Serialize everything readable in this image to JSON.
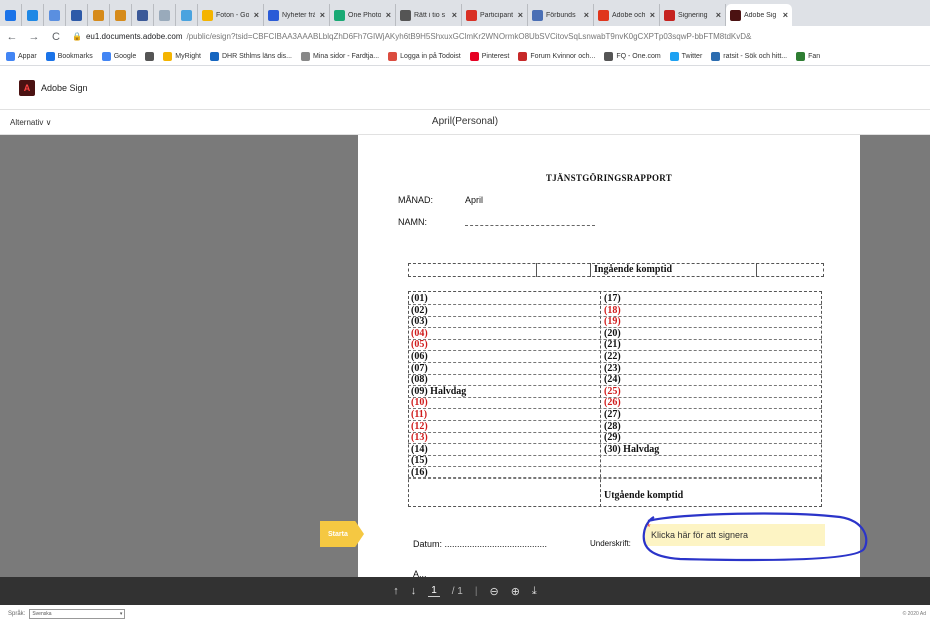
{
  "tabs": [
    {
      "label": "",
      "color": "#1b73e8",
      "active": false
    },
    {
      "label": "",
      "color": "#1e88e5",
      "active": false
    },
    {
      "label": "",
      "color": "#5a8fe0",
      "active": false
    },
    {
      "label": "",
      "color": "#2e5aa8",
      "active": false
    },
    {
      "label": "",
      "color": "#d68b1b",
      "active": false
    },
    {
      "label": "",
      "color": "#d68b1b",
      "active": false
    },
    {
      "label": "",
      "color": "#3b5998",
      "active": false
    },
    {
      "label": "",
      "color": "#9ab",
      "active": false
    },
    {
      "label": "",
      "color": "#4aa3df",
      "active": false
    },
    {
      "label": "Foton - Go",
      "color": "#f4b400",
      "active": false
    },
    {
      "label": "Nyheter frå",
      "color": "#2a5bd7",
      "active": false
    },
    {
      "label": "One Photo",
      "color": "#19a974",
      "active": false
    },
    {
      "label": "Rätt i tio s",
      "color": "#555",
      "active": false
    },
    {
      "label": "Participant",
      "color": "#d93025",
      "active": false
    },
    {
      "label": "Förbunds",
      "color": "#4a6fb5",
      "active": false
    },
    {
      "label": "Adobe och",
      "color": "#e0361c",
      "active": false
    },
    {
      "label": "Signering",
      "color": "#c5221f",
      "active": false
    },
    {
      "label": "Adobe Sig",
      "color": "#4b1212",
      "active": true
    }
  ],
  "addressbar": {
    "host": "eu1.documents.adobe.com",
    "path": "/public/esign?tsid=CBFCIBAA3AAABLblqZhD6Fh7GIWjAKyh6tB9H5ShxuxGClmKr2WNOrmkO8UbSVCitovSqLsnwabT9nvK0gCXPTp03sqwP-bbFTM8tdKvD&"
  },
  "bookmarks": [
    {
      "label": "Appar",
      "color": "#4285f4"
    },
    {
      "label": "Bookmarks",
      "color": "#1a73e8"
    },
    {
      "label": "Google",
      "color": "#4285f4"
    },
    {
      "label": "",
      "color": "#555"
    },
    {
      "label": "MyRight",
      "color": "#f4b400"
    },
    {
      "label": "DHR Sthlms läns dis...",
      "color": "#1565c0"
    },
    {
      "label": "Mina sidor - Fardtja...",
      "color": "#888"
    },
    {
      "label": "Logga in på Todoist",
      "color": "#db4c3f"
    },
    {
      "label": "Pinterest",
      "color": "#e60023"
    },
    {
      "label": "Forum Kvinnor och...",
      "color": "#c62828"
    },
    {
      "label": "FQ - One.com",
      "color": "#555"
    },
    {
      "label": "Twitter",
      "color": "#1da1f2"
    },
    {
      "label": "ratsit - Sök och hitt...",
      "color": "#2b6cb0"
    },
    {
      "label": "Fan",
      "color": "#2e7d32"
    }
  ],
  "app": {
    "brand": "Adobe Sign",
    "options": "Alternativ ∨",
    "doc_title": "April(Personal)"
  },
  "document": {
    "heading": "TJÄNSTGÖRINGSRAPPORT",
    "month_label": "MÅNAD:",
    "month_value": "April",
    "name_label": "NAMN:",
    "incoming_label": "Ingående komptid",
    "outgoing_label": "Utgående komptid",
    "left_days": [
      {
        "t": "(01)",
        "red": false
      },
      {
        "t": "(02)",
        "red": false
      },
      {
        "t": "(03)",
        "red": false
      },
      {
        "t": "(04)",
        "red": true
      },
      {
        "t": "(05)",
        "red": true
      },
      {
        "t": "(06)",
        "red": false
      },
      {
        "t": "(07)",
        "red": false
      },
      {
        "t": "(08)",
        "red": false
      },
      {
        "t": "(09) Halvdag",
        "red": false
      },
      {
        "t": "(10)",
        "red": true
      },
      {
        "t": "(11)",
        "red": true
      },
      {
        "t": "(12)",
        "red": true
      },
      {
        "t": "(13)",
        "red": true
      },
      {
        "t": "(14)",
        "red": false
      },
      {
        "t": "(15)",
        "red": false
      },
      {
        "t": "(16)",
        "red": false
      }
    ],
    "right_days": [
      {
        "t": "(17)",
        "red": false
      },
      {
        "t": "(18)",
        "red": true
      },
      {
        "t": "(19)",
        "red": true
      },
      {
        "t": "(20)",
        "red": false
      },
      {
        "t": "(21)",
        "red": false
      },
      {
        "t": "(22)",
        "red": false
      },
      {
        "t": "(23)",
        "red": false
      },
      {
        "t": "(24)",
        "red": false
      },
      {
        "t": "(25)",
        "red": true
      },
      {
        "t": "(26)",
        "red": true
      },
      {
        "t": "(27)",
        "red": false
      },
      {
        "t": "(28)",
        "red": false
      },
      {
        "t": "(29)",
        "red": false
      },
      {
        "t": "(30) Halvdag",
        "red": false
      }
    ],
    "date_label": "Datum: .........................................",
    "signature_label": "Underskrift:",
    "signature_prompt": "Klicka här för att signera",
    "start_label": "Starta",
    "bottom_cut": "A..."
  },
  "pagebar": {
    "current_page": "1",
    "total_pages": "/ 1"
  },
  "footer": {
    "language_label": "Språk:",
    "language_value": "Svenska",
    "copyright": "© 2020 Ad"
  }
}
